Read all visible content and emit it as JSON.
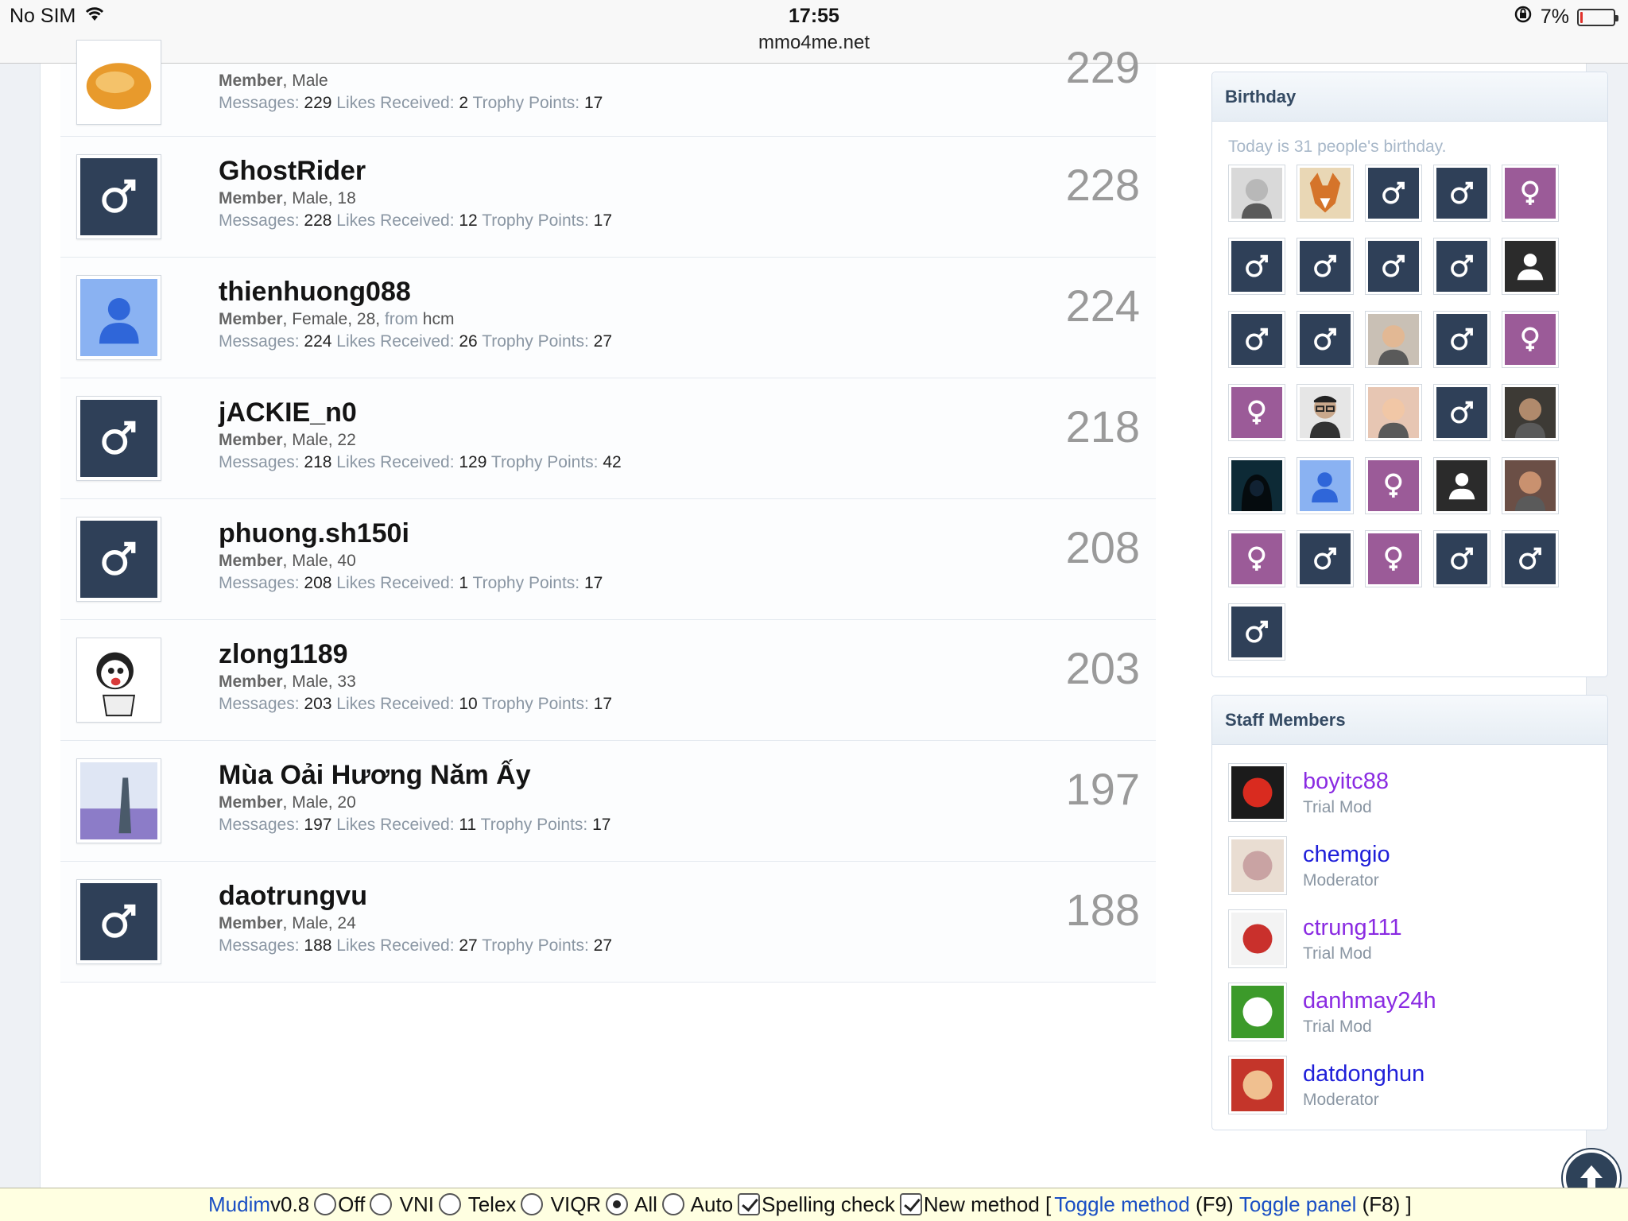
{
  "status_bar": {
    "carrier": "No SIM",
    "time": "17:55",
    "url": "mmo4me.net",
    "battery": "7%",
    "battery_level": 0.07
  },
  "labels": {
    "messages": "Messages:",
    "likes": "Likes Received:",
    "trophy": "Trophy Points:",
    "from": "from"
  },
  "members": [
    {
      "name": "",
      "role": "Member",
      "details": ", Male",
      "from": "",
      "messages": "229",
      "likes": "2",
      "trophy": "17",
      "count": "229",
      "avatar": "food"
    },
    {
      "name": "GhostRider",
      "role": "Member",
      "details": ", Male, 18",
      "from": "",
      "messages": "228",
      "likes": "12",
      "trophy": "17",
      "count": "228",
      "avatar": "male"
    },
    {
      "name": "thienhuong088",
      "role": "Member",
      "details": ", Female, 28, ",
      "from": "hcm",
      "messages": "224",
      "likes": "26",
      "trophy": "27",
      "count": "224",
      "avatar": "blue-person"
    },
    {
      "name": "jACKIE_n0",
      "role": "Member",
      "details": ", Male, 22",
      "from": "",
      "messages": "218",
      "likes": "129",
      "trophy": "42",
      "count": "218",
      "avatar": "male"
    },
    {
      "name": "phuong.sh150i",
      "role": "Member",
      "details": ", Male, 40",
      "from": "",
      "messages": "208",
      "likes": "1",
      "trophy": "17",
      "count": "208",
      "avatar": "male"
    },
    {
      "name": "zlong1189",
      "role": "Member",
      "details": ", Male, 33",
      "from": "",
      "messages": "203",
      "likes": "10",
      "trophy": "17",
      "count": "203",
      "avatar": "cartoon"
    },
    {
      "name": "Mùa Oải Hương Năm Ấy",
      "role": "Member",
      "details": ", Male, 20",
      "from": "",
      "messages": "197",
      "likes": "11",
      "trophy": "17",
      "count": "197",
      "avatar": "photo-lavender"
    },
    {
      "name": "daotrungvu",
      "role": "Member",
      "details": ", Male, 24",
      "from": "",
      "messages": "188",
      "likes": "27",
      "trophy": "27",
      "count": "188",
      "avatar": "male"
    }
  ],
  "birthday": {
    "title": "Birthday",
    "text": "Today is 31 people's birthday.",
    "avatars": [
      "photo-gray",
      "photo-fox",
      "male",
      "male",
      "female",
      "male",
      "male",
      "male",
      "male",
      "silhouette",
      "male",
      "male",
      "photo-kid",
      "male",
      "female",
      "female",
      "photo-glasses",
      "photo-baby",
      "male",
      "photo-dark",
      "photo-hood",
      "blue-person",
      "female",
      "silhouette",
      "photo-pic",
      "female",
      "male",
      "female",
      "male",
      "male",
      "male"
    ]
  },
  "staff": {
    "title": "Staff Members",
    "members": [
      {
        "name": "boyitc88",
        "role": "Trial Mod",
        "color": "#8a2be2",
        "avatar_color": "#1b1b1b",
        "avatar_accent": "#d92b1f"
      },
      {
        "name": "chemgio",
        "role": "Moderator",
        "color": "#1f1fd9",
        "avatar_color": "#e9ddd2",
        "avatar_accent": "#c9a3a3"
      },
      {
        "name": "ctrung111",
        "role": "Trial Mod",
        "color": "#8a2be2",
        "avatar_color": "#f3f3f3",
        "avatar_accent": "#c9302c"
      },
      {
        "name": "danhmay24h",
        "role": "Trial Mod",
        "color": "#8a2be2",
        "avatar_color": "#3c9a2a",
        "avatar_accent": "#ffffff"
      },
      {
        "name": "datdonghun",
        "role": "Moderator",
        "color": "#1f1fd9",
        "avatar_color": "#c4352a",
        "avatar_accent": "#f0c090"
      }
    ]
  },
  "ime_bar": {
    "name": "Mudim",
    "version": " v0.8",
    "options": [
      {
        "label": "Off",
        "selected": false
      },
      {
        "label": " VNI",
        "selected": false
      },
      {
        "label": " Telex",
        "selected": false
      },
      {
        "label": " VIQR",
        "selected": false
      },
      {
        "label": " All",
        "selected": true
      },
      {
        "label": " Auto",
        "selected": false
      }
    ],
    "checks": [
      {
        "label": "Spelling check",
        "checked": true
      },
      {
        "label": "New method [ ",
        "checked": true
      }
    ],
    "toggle_method": "Toggle method",
    "toggle_method_key": " (F9) ",
    "toggle_panel": "Toggle panel",
    "toggle_panel_key": " (F8) ]"
  }
}
